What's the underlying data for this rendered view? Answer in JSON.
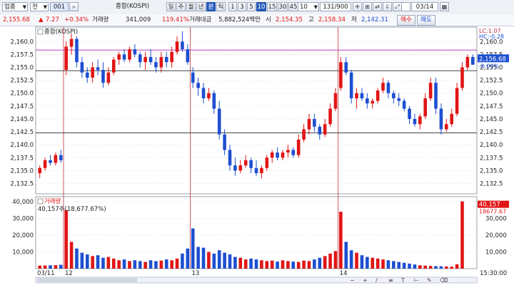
{
  "toolbar": {
    "market_select": "업종",
    "market_arrow": "▼",
    "type_select": "전",
    "code_value": "001",
    "index_name": "종합(KOSPI)",
    "periods": [
      "일",
      "주",
      "월",
      "년",
      "분",
      "틱"
    ],
    "active_period": "분",
    "intervals": [
      "1",
      "3",
      "5",
      "10",
      "15",
      "30",
      "45",
      "60"
    ],
    "active_interval": "10",
    "interval_select": "10",
    "counter": "131/900",
    "date_value": "03/14",
    "tool_icons": [
      "crosshair-icon",
      "indicator-icon",
      "compare-icon",
      "down-arrow-icon",
      "expand-icon"
    ]
  },
  "quote": {
    "price": "2,155.68",
    "arrow": "▲",
    "change": "7.27",
    "change_pct": "+0.34%",
    "vol_label": "거래량",
    "volume": "341,009",
    "volume_pct": "119.41%",
    "amount_label": "거래대금",
    "amount": "5,882,524백만",
    "open_label": "시",
    "open": "2,154.35",
    "high_label": "고",
    "high": "2,158.34",
    "low_label": "저",
    "low": "2,142.31",
    "buy_label": "매수",
    "sell_label": "매도"
  },
  "chart_data": [
    {
      "type": "candlestick",
      "title": "종합(KOSPI)",
      "y_ticks": [
        2160,
        2157.5,
        2155,
        2152.5,
        2150,
        2147.5,
        2145,
        2142.5,
        2140,
        2137.5,
        2135,
        2132.5
      ],
      "ylim": [
        2130.5,
        2162.8
      ],
      "x_labels": [
        "03/11",
        "12",
        "13",
        "14"
      ],
      "info_text": [
        "LC:1.07",
        "HC:-0.28"
      ],
      "last_price_label": "2,156.68",
      "last_pct_label": "-0.09%",
      "horizontal_lines": [
        {
          "value": 2158.34,
          "color": "#c040c0"
        },
        {
          "value": 2154.35,
          "color": "#444444"
        },
        {
          "value": 2142.31,
          "color": "#444444"
        }
      ],
      "day_start_indices": [
        5,
        29,
        57
      ],
      "candles": [
        [
          2134.5,
          2136.0,
          2133.5,
          2135.5
        ],
        [
          2135.5,
          2137.5,
          2135.0,
          2137.0
        ],
        [
          2137.0,
          2138.0,
          2136.0,
          2136.5
        ],
        [
          2136.5,
          2138.5,
          2136.0,
          2138.0
        ],
        [
          2138.0,
          2139.0,
          2136.5,
          2137.0
        ],
        [
          2154.5,
          2160.0,
          2153.5,
          2159.0
        ],
        [
          2159.0,
          2161.5,
          2157.5,
          2160.5
        ],
        [
          2160.5,
          2161.0,
          2155.0,
          2156.0
        ],
        [
          2156.0,
          2157.0,
          2153.0,
          2154.0
        ],
        [
          2154.0,
          2155.0,
          2152.0,
          2153.0
        ],
        [
          2153.0,
          2156.0,
          2152.0,
          2155.0
        ],
        [
          2155.0,
          2156.5,
          2153.5,
          2154.5
        ],
        [
          2154.5,
          2156.0,
          2151.0,
          2152.0
        ],
        [
          2152.0,
          2155.0,
          2151.5,
          2154.0
        ],
        [
          2154.0,
          2157.0,
          2153.5,
          2156.5
        ],
        [
          2156.5,
          2158.0,
          2155.5,
          2157.5
        ],
        [
          2157.5,
          2158.5,
          2156.0,
          2156.5
        ],
        [
          2156.5,
          2159.0,
          2156.0,
          2158.5
        ],
        [
          2158.5,
          2159.5,
          2157.0,
          2157.5
        ],
        [
          2157.5,
          2158.0,
          2155.0,
          2156.0
        ],
        [
          2156.0,
          2158.0,
          2154.5,
          2157.0
        ],
        [
          2157.0,
          2158.5,
          2155.5,
          2156.0
        ],
        [
          2156.0,
          2157.0,
          2154.0,
          2155.0
        ],
        [
          2155.0,
          2158.0,
          2154.0,
          2157.0
        ],
        [
          2157.0,
          2158.0,
          2155.0,
          2156.0
        ],
        [
          2156.0,
          2159.0,
          2155.0,
          2158.0
        ],
        [
          2158.0,
          2161.0,
          2157.5,
          2160.0
        ],
        [
          2160.0,
          2162.0,
          2158.0,
          2158.5
        ],
        [
          2158.5,
          2159.5,
          2155.5,
          2156.0
        ],
        [
          2154.0,
          2155.0,
          2151.0,
          2152.0
        ],
        [
          2152.0,
          2153.0,
          2149.5,
          2151.0
        ],
        [
          2151.0,
          2152.0,
          2148.0,
          2149.0
        ],
        [
          2149.0,
          2151.0,
          2148.5,
          2150.0
        ],
        [
          2150.0,
          2150.5,
          2146.0,
          2147.0
        ],
        [
          2147.0,
          2148.5,
          2141.0,
          2142.0
        ],
        [
          2142.0,
          2143.0,
          2138.0,
          2139.0
        ],
        [
          2139.0,
          2140.0,
          2135.0,
          2136.0
        ],
        [
          2136.0,
          2137.5,
          2134.0,
          2135.0
        ],
        [
          2135.0,
          2137.0,
          2134.5,
          2136.0
        ],
        [
          2136.0,
          2138.0,
          2135.5,
          2137.0
        ],
        [
          2137.0,
          2137.5,
          2134.5,
          2135.5
        ],
        [
          2135.5,
          2137.0,
          2134.0,
          2134.5
        ],
        [
          2134.5,
          2136.0,
          2133.5,
          2135.5
        ],
        [
          2135.5,
          2138.0,
          2135.0,
          2137.5
        ],
        [
          2137.5,
          2139.0,
          2136.5,
          2138.5
        ],
        [
          2138.5,
          2139.5,
          2137.0,
          2137.5
        ],
        [
          2137.5,
          2139.0,
          2137.0,
          2138.5
        ],
        [
          2138.5,
          2140.0,
          2137.5,
          2139.0
        ],
        [
          2139.0,
          2139.5,
          2137.5,
          2138.0
        ],
        [
          2138.0,
          2142.0,
          2137.5,
          2141.0
        ],
        [
          2141.0,
          2144.0,
          2140.5,
          2143.0
        ],
        [
          2143.0,
          2146.0,
          2142.0,
          2145.0
        ],
        [
          2145.0,
          2146.0,
          2142.5,
          2143.5
        ],
        [
          2143.5,
          2144.0,
          2141.0,
          2142.0
        ],
        [
          2142.0,
          2145.0,
          2141.5,
          2144.0
        ],
        [
          2144.0,
          2148.0,
          2143.5,
          2147.0
        ],
        [
          2147.0,
          2151.0,
          2146.5,
          2150.0
        ],
        [
          2151.0,
          2157.0,
          2150.5,
          2156.0
        ],
        [
          2156.0,
          2157.0,
          2153.5,
          2154.0
        ],
        [
          2154.0,
          2154.5,
          2148.0,
          2149.0
        ],
        [
          2149.0,
          2151.0,
          2147.0,
          2150.0
        ],
        [
          2150.0,
          2151.0,
          2148.5,
          2149.0
        ],
        [
          2149.0,
          2150.0,
          2147.0,
          2148.0
        ],
        [
          2148.0,
          2149.0,
          2147.0,
          2148.5
        ],
        [
          2148.5,
          2151.0,
          2148.0,
          2150.5
        ],
        [
          2150.5,
          2153.0,
          2150.0,
          2152.0
        ],
        [
          2152.0,
          2152.5,
          2149.0,
          2150.0
        ],
        [
          2150.0,
          2150.5,
          2148.0,
          2149.0
        ],
        [
          2149.0,
          2150.0,
          2147.5,
          2148.5
        ],
        [
          2148.5,
          2149.0,
          2146.5,
          2147.0
        ],
        [
          2147.0,
          2147.5,
          2144.0,
          2145.0
        ],
        [
          2145.0,
          2146.0,
          2143.5,
          2144.0
        ],
        [
          2144.0,
          2146.0,
          2143.0,
          2145.5
        ],
        [
          2145.5,
          2150.0,
          2145.0,
          2149.0
        ],
        [
          2149.0,
          2153.0,
          2148.5,
          2152.0
        ],
        [
          2152.0,
          2153.0,
          2146.0,
          2147.0
        ],
        [
          2147.0,
          2148.0,
          2142.0,
          2143.0
        ],
        [
          2143.0,
          2145.0,
          2142.5,
          2144.0
        ],
        [
          2144.0,
          2147.0,
          2143.5,
          2146.0
        ],
        [
          2146.0,
          2152.0,
          2145.5,
          2151.0
        ],
        [
          2151.0,
          2156.0,
          2150.5,
          2155.0
        ],
        [
          2155.0,
          2157.5,
          2154.5,
          2157.0
        ],
        [
          2157.0,
          2157.5,
          2155.5,
          2155.5
        ]
      ]
    },
    {
      "type": "bar",
      "title": "거래량",
      "subtitle": "40,157주(18,677.67%)",
      "y_ticks": [
        10000,
        20000,
        30000,
        40000
      ],
      "y_tick_labels": [
        "10,000",
        "20,000",
        "30,000",
        "40,000"
      ],
      "right_ticks": [
        10000,
        20000,
        30000
      ],
      "ylim": [
        0,
        43000
      ],
      "last_value_label": "40,157",
      "last_pct_label": "18677.67",
      "time_label": "15:30:00",
      "values": [
        1800,
        1900,
        2000,
        2100,
        2300,
        35000,
        16000,
        12000,
        9500,
        8500,
        7500,
        8000,
        6500,
        7000,
        6000,
        5000,
        5500,
        4500,
        5000,
        4500,
        4000,
        5000,
        4500,
        4800,
        5500,
        5000,
        6000,
        9000,
        12000,
        24000,
        13000,
        12500,
        10000,
        9000,
        11000,
        9500,
        8500,
        7000,
        6500,
        5500,
        6000,
        5500,
        5000,
        4500,
        4800,
        4200,
        5000,
        4500,
        4200,
        4000,
        4800,
        4500,
        5500,
        6500,
        7500,
        9000,
        10500,
        34000,
        16000,
        11000,
        9500,
        8000,
        7000,
        6500,
        6000,
        5500,
        5000,
        4500,
        4000,
        3500,
        3000,
        2500,
        2000,
        1800,
        1600,
        1500,
        1400,
        1300,
        1200,
        2600,
        40157
      ],
      "colors_by_candle": true
    }
  ],
  "footer": {
    "scroll_label": "◀ ▶",
    "tool_icons": [
      "zoom-out-icon",
      "zoom-in-icon",
      "line-tool-icon",
      "fib-tool-icon",
      "text-tool-icon",
      "ruler-tool-icon",
      "pen-tool-icon",
      "erase-tool-icon"
    ]
  },
  "colors": {
    "up": "#e01515",
    "down": "#1d4fd1",
    "grid": "#e6e6e6",
    "price_line": "#c040c0",
    "last_box": "#1d4fd1",
    "last_box_red": "#e01515"
  }
}
